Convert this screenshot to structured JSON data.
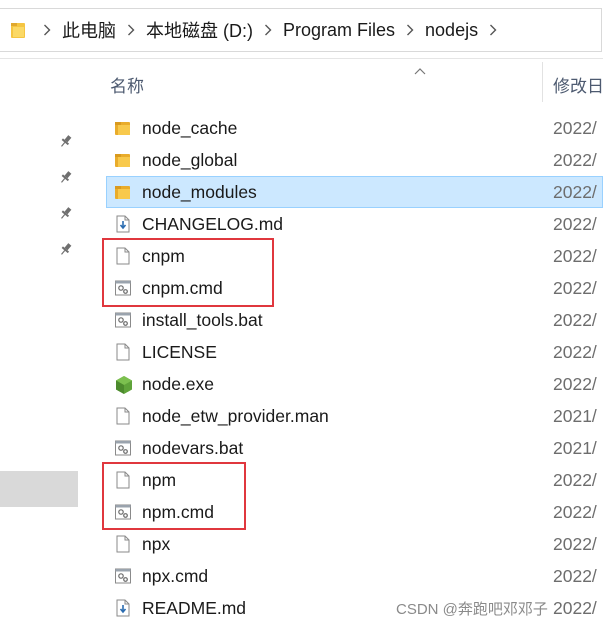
{
  "breadcrumb": {
    "items": [
      "此电脑",
      "本地磁盘 (D:)",
      "Program Files",
      "nodejs"
    ]
  },
  "columns": {
    "name": "名称",
    "date": "修改日"
  },
  "files": [
    {
      "name": "node_cache",
      "date": "2022/",
      "icon": "folder-icon"
    },
    {
      "name": "node_global",
      "date": "2022/",
      "icon": "folder-icon"
    },
    {
      "name": "node_modules",
      "date": "2022/",
      "icon": "folder-icon",
      "selected": true
    },
    {
      "name": "CHANGELOG.md",
      "date": "2022/",
      "icon": "markdown-file-icon"
    },
    {
      "name": "cnpm",
      "date": "2022/",
      "icon": "blank-file-icon"
    },
    {
      "name": "cnpm.cmd",
      "date": "2022/",
      "icon": "batch-file-icon"
    },
    {
      "name": "install_tools.bat",
      "date": "2022/",
      "icon": "batch-file-icon"
    },
    {
      "name": "LICENSE",
      "date": "2022/",
      "icon": "blank-file-icon"
    },
    {
      "name": "node.exe",
      "date": "2022/",
      "icon": "node-exe-icon"
    },
    {
      "name": "node_etw_provider.man",
      "date": "2021/",
      "icon": "blank-file-icon"
    },
    {
      "name": "nodevars.bat",
      "date": "2021/",
      "icon": "batch-file-icon"
    },
    {
      "name": "npm",
      "date": "2022/",
      "icon": "blank-file-icon"
    },
    {
      "name": "npm.cmd",
      "date": "2022/",
      "icon": "batch-file-icon"
    },
    {
      "name": "npx",
      "date": "2022/",
      "icon": "blank-file-icon"
    },
    {
      "name": "npx.cmd",
      "date": "2022/",
      "icon": "batch-file-icon"
    },
    {
      "name": "README.md",
      "date": "2022/",
      "icon": "markdown-file-icon"
    }
  ],
  "watermark": "CSDN @奔跑吧邓邓子",
  "colors": {
    "selection_bg": "#cce8ff",
    "selection_border": "#99d1ff",
    "highlight_red": "#e0373e",
    "folder_yellow": "#f5c542",
    "node_green": "#5fa33a"
  }
}
